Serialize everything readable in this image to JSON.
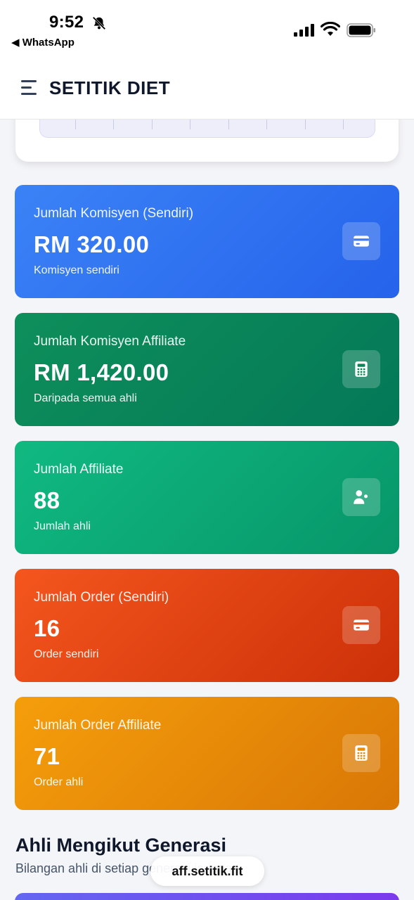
{
  "status_bar": {
    "time": "9:52",
    "back_app": "◀ WhatsApp"
  },
  "header": {
    "title": "SETITIK DIET"
  },
  "stats": [
    {
      "label": "Jumlah Komisyen (Sendiri)",
      "value": "RM 320.00",
      "sub": "Komisyen sendiri",
      "icon": "credit-card-icon",
      "color": "#2563eb"
    },
    {
      "label": "Jumlah Komisyen Affiliate",
      "value": "RM 1,420.00",
      "sub": "Daripada semua ahli",
      "icon": "calculator-icon",
      "color": "#047857"
    },
    {
      "label": "Jumlah Affiliate",
      "value": "88",
      "sub": "Jumlah ahli",
      "icon": "users-icon",
      "color": "#10b981"
    },
    {
      "label": "Jumlah Order (Sendiri)",
      "value": "16",
      "sub": "Order sendiri",
      "icon": "credit-card-icon",
      "color": "#ea4c14"
    },
    {
      "label": "Jumlah Order Affiliate",
      "value": "71",
      "sub": "Order ahli",
      "icon": "calculator-icon",
      "color": "#f59e0b"
    }
  ],
  "section": {
    "title": "Ahli Mengikut Generasi",
    "subtitle": "Bilangan ahli di setiap generasi jaringan"
  },
  "browser": {
    "url": "aff.setitik.fit"
  }
}
